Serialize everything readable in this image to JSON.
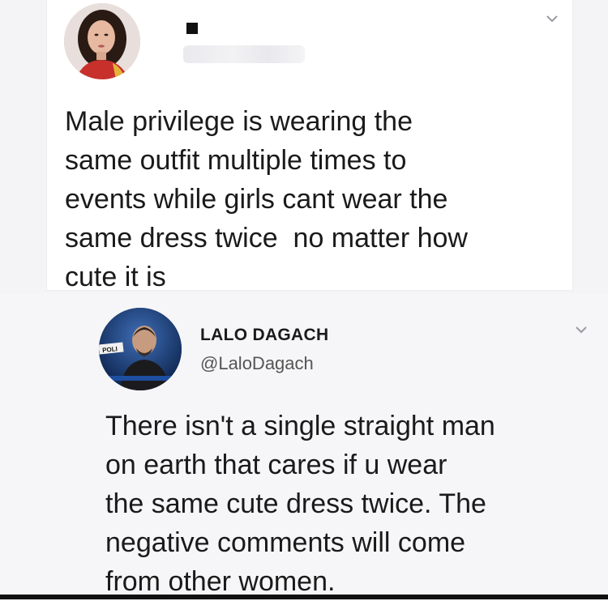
{
  "original_tweet": {
    "avatar_icon": "profile-photo-woman",
    "text": "Male privilege is wearing the\nsame outfit multiple times to\nevents while girls cant wear the\nsame dress twice  no matter how\ncute it is"
  },
  "reply_tweet": {
    "avatar_icon": "profile-photo-man",
    "avatar_badge": "POLI",
    "display_name": "LALO DAGACH",
    "handle": "@LaloDagach",
    "text": "There isn't a single straight man\non earth that cares if u wear\nthe same cute dress twice. The\nnegative comments will come\nfrom other women."
  },
  "icons": {
    "menu_chevron": "chevron-down-icon"
  },
  "colors": {
    "text": "#1a1a1a",
    "handle": "#555555",
    "chevron": "#9a9aa0"
  }
}
